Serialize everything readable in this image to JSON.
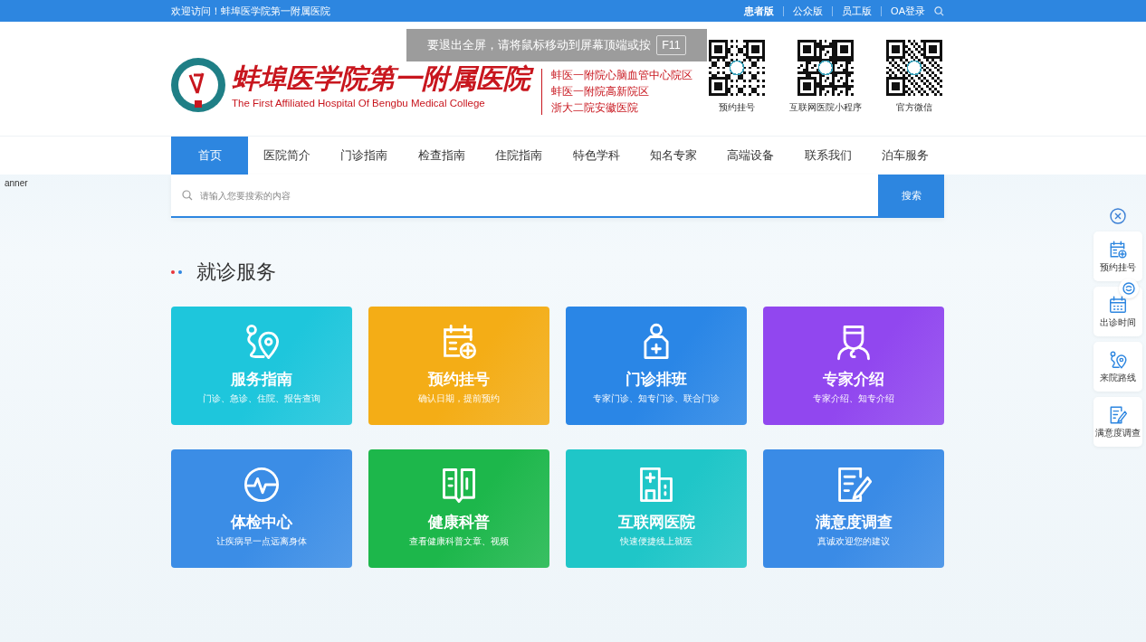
{
  "top_bar": {
    "welcome": "欢迎访问！蚌埠医学院第一附属医院",
    "links": [
      {
        "label": "患者版",
        "selected": true
      },
      {
        "label": "公众版",
        "selected": false
      },
      {
        "label": "员工版",
        "selected": false
      },
      {
        "label": "OA登录",
        "selected": false
      }
    ]
  },
  "header": {
    "logo_title": "蚌埠医学院第一附属医院",
    "logo_subtitle": "The First Affiliated Hospital Of Bengbu Medical College",
    "campuses": [
      "蚌医一附院心脑血管中心院区",
      "蚌医一附院高新院区",
      "浙大二院安徽医院"
    ],
    "qr_codes": [
      {
        "label": "预约挂号"
      },
      {
        "label": "互联网医院小程序"
      },
      {
        "label": "官方微信"
      }
    ]
  },
  "fullscreen_notice": {
    "text": "要退出全屏，请将鼠标移动到屏幕顶端或按",
    "key": "F11"
  },
  "nav": {
    "items": [
      {
        "label": "首页",
        "selected": true
      },
      {
        "label": "医院简介",
        "selected": false
      },
      {
        "label": "门诊指南",
        "selected": false
      },
      {
        "label": "检查指南",
        "selected": false
      },
      {
        "label": "住院指南",
        "selected": false
      },
      {
        "label": "特色学科",
        "selected": false
      },
      {
        "label": "知名专家",
        "selected": false
      },
      {
        "label": "高端设备",
        "selected": false
      },
      {
        "label": "联系我们",
        "selected": false
      },
      {
        "label": "泊车服务",
        "selected": false
      }
    ]
  },
  "banner_alt": "anner",
  "search": {
    "placeholder": "请输入您要搜索的内容",
    "button": "搜索"
  },
  "section": {
    "title": "就诊服务",
    "cards": [
      {
        "title": "服务指南",
        "subtitle": "门诊、急诊、住院、报告查询",
        "color": "#1ec6dc",
        "kind": "route"
      },
      {
        "title": "预约挂号",
        "subtitle": "确认日期，提前预约",
        "color": "#f4ad16",
        "kind": "calendar"
      },
      {
        "title": "门诊排班",
        "subtitle": "专家门诊、知专门诊、联合门诊",
        "color": "#2a86e6",
        "kind": "kit"
      },
      {
        "title": "专家介绍",
        "subtitle": "专家介绍、知专介绍",
        "color": "#9147ef",
        "kind": "doctor"
      },
      {
        "title": "体检中心",
        "subtitle": "让疾病早一点远离身体",
        "color": "#3b8de6",
        "kind": "pulse"
      },
      {
        "title": "健康科普",
        "subtitle": "查看健康科普文章、视频",
        "color": "#1db74b",
        "kind": "book"
      },
      {
        "title": "互联网医院",
        "subtitle": "快速便捷线上就医",
        "color": "#1fc6c8",
        "kind": "hospital"
      },
      {
        "title": "满意度调查",
        "subtitle": "真诚欢迎您的建议",
        "color": "#3a8be6",
        "kind": "form"
      }
    ]
  },
  "side_panel": {
    "items": [
      {
        "label": "预约挂号",
        "kind": "calendar"
      },
      {
        "label": "出诊时间",
        "kind": "schedule"
      },
      {
        "label": "来院路线",
        "kind": "route"
      },
      {
        "label": "满意度调查",
        "kind": "form"
      }
    ]
  }
}
